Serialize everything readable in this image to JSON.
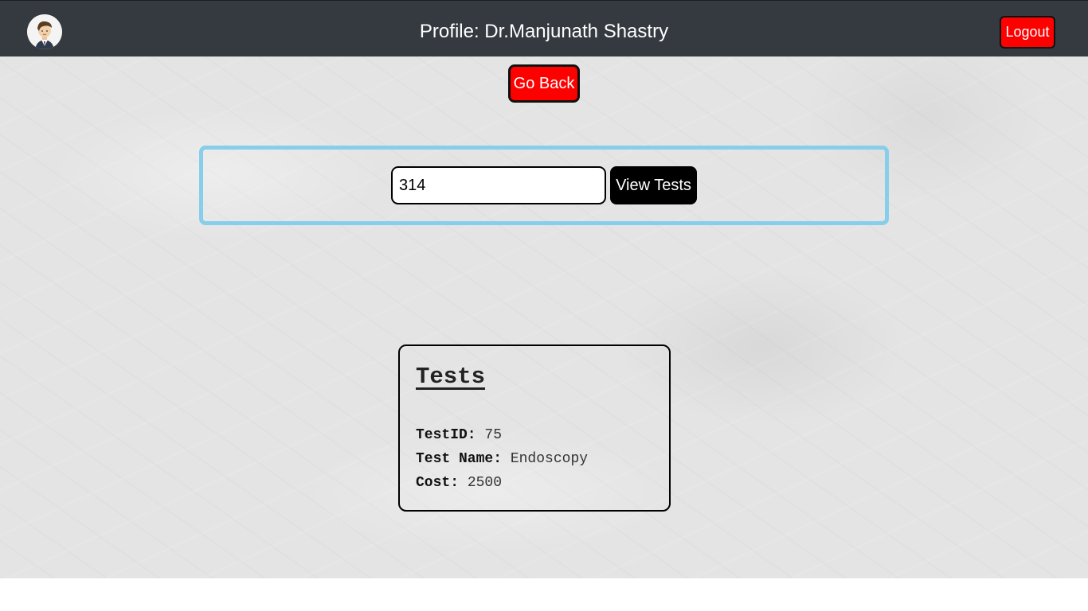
{
  "header": {
    "title": "Profile: Dr.Manjunath Shastry",
    "logout_label": "Logout",
    "avatar_icon": "doctor-avatar-icon"
  },
  "go_back_label": "Go Back",
  "search": {
    "input_value": "314",
    "button_label": "View Tests",
    "panel_border_color": "#87ceeb"
  },
  "tests_card": {
    "title": "Tests",
    "rows": [
      {
        "label": "TestID:",
        "value": "75"
      },
      {
        "label": "Test Name:",
        "value": "Endoscopy"
      },
      {
        "label": "Cost:",
        "value": "2500"
      }
    ]
  },
  "colors": {
    "navbar": "#343a40",
    "danger_button": "#ff0000",
    "primary_button": "#000000"
  }
}
